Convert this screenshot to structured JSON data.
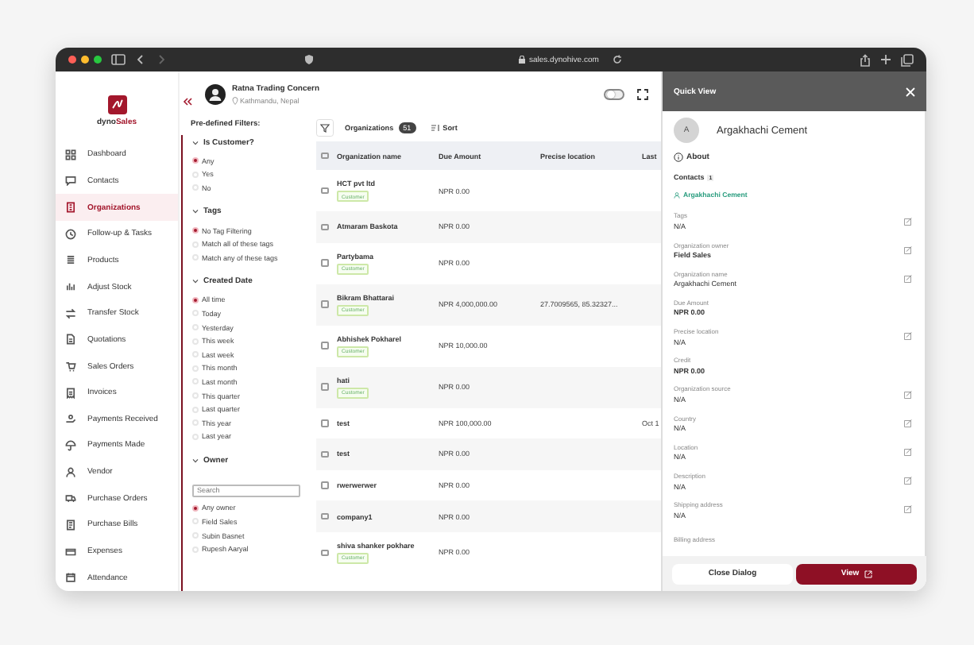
{
  "browser": {
    "url": "sales.dynohive.com"
  },
  "logo": {
    "part1": "dyno",
    "part2": "Sales"
  },
  "nav": [
    {
      "label": "Dashboard",
      "selected": false
    },
    {
      "label": "Contacts",
      "selected": false
    },
    {
      "label": "Organizations",
      "selected": true
    },
    {
      "label": "Follow-up & Tasks",
      "selected": false
    },
    {
      "label": "Products",
      "selected": false
    },
    {
      "label": "Adjust Stock",
      "selected": false
    },
    {
      "label": "Transfer Stock",
      "selected": false
    },
    {
      "label": "Quotations",
      "selected": false
    },
    {
      "label": "Sales Orders",
      "selected": false
    },
    {
      "label": "Invoices",
      "selected": false
    },
    {
      "label": "Payments Received",
      "selected": false
    },
    {
      "label": "Payments Made",
      "selected": false
    },
    {
      "label": "Vendor",
      "selected": false
    },
    {
      "label": "Purchase Orders",
      "selected": false
    },
    {
      "label": "Purchase Bills",
      "selected": false
    },
    {
      "label": "Expenses",
      "selected": false
    },
    {
      "label": "Attendance",
      "selected": false
    }
  ],
  "account": {
    "name": "Ratna Trading Concern",
    "location": "Kathmandu, Nepal"
  },
  "toggle": {
    "on": false
  },
  "filters": {
    "title": "Pre-defined Filters:",
    "sections": [
      {
        "title": "Is Customer?",
        "expanded": true,
        "options": [
          {
            "label": "Any",
            "selected": true
          },
          {
            "label": "Yes",
            "selected": false
          },
          {
            "label": "No",
            "selected": false
          }
        ]
      },
      {
        "title": "Tags",
        "expanded": true,
        "options": [
          {
            "label": "No Tag Filtering",
            "selected": true
          },
          {
            "label": "Match all of these tags",
            "selected": false
          },
          {
            "label": "Match any of these tags",
            "selected": false
          }
        ]
      },
      {
        "title": "Created Date",
        "expanded": true,
        "options": [
          {
            "label": "All time",
            "selected": true
          },
          {
            "label": "Today",
            "selected": false
          },
          {
            "label": "Yesterday",
            "selected": false
          },
          {
            "label": "This week",
            "selected": false
          },
          {
            "label": "Last week",
            "selected": false
          },
          {
            "label": "This month",
            "selected": false
          },
          {
            "label": "Last month",
            "selected": false
          },
          {
            "label": "This quarter",
            "selected": false
          },
          {
            "label": "Last quarter",
            "selected": false
          },
          {
            "label": "This year",
            "selected": false
          },
          {
            "label": "Last year",
            "selected": false
          }
        ]
      },
      {
        "title": "Owner",
        "expanded": true,
        "search_placeholder": "Search",
        "options": [
          {
            "label": "Any owner",
            "selected": true
          },
          {
            "label": "Field Sales",
            "selected": false
          },
          {
            "label": "Subin Basnet",
            "selected": false
          },
          {
            "label": "Rupesh Aaryal",
            "selected": false
          }
        ]
      }
    ]
  },
  "toolbar": {
    "label": "Organizations",
    "count": "51",
    "sort": "Sort"
  },
  "table": {
    "select_all_checked": false,
    "columns": [
      "Organization name",
      "Due Amount",
      "Precise location",
      "Last"
    ],
    "rows": [
      {
        "cells": [
          "HCT pvt ltd",
          "NPR 0.00",
          "",
          ""
        ],
        "tag": "Customer",
        "checked": false
      },
      {
        "cells": [
          "Atmaram Baskota",
          "NPR 0.00",
          "",
          ""
        ],
        "checked": false
      },
      {
        "cells": [
          "Partybama",
          "NPR 0.00",
          "",
          ""
        ],
        "tag": "Customer",
        "checked": false
      },
      {
        "cells": [
          "Bikram Bhattarai",
          "NPR 4,000,000.00",
          "27.7009565, 85.32327...",
          ""
        ],
        "tag": "Customer",
        "checked": false
      },
      {
        "cells": [
          "Abhishek Pokharel",
          "NPR 10,000.00",
          "",
          ""
        ],
        "tag": "Customer",
        "checked": false
      },
      {
        "cells": [
          "hati",
          "NPR 0.00",
          "",
          ""
        ],
        "tag": "Customer",
        "checked": false
      },
      {
        "cells": [
          "test",
          "NPR 100,000.00",
          "",
          "Oct 1"
        ],
        "checked": false
      },
      {
        "cells": [
          "test",
          "NPR 0.00",
          "",
          ""
        ],
        "checked": false
      },
      {
        "cells": [
          "rwerwerwer",
          "NPR 0.00",
          "",
          ""
        ],
        "checked": false
      },
      {
        "cells": [
          "company1",
          "NPR 0.00",
          "",
          ""
        ],
        "checked": false
      },
      {
        "cells": [
          "shiva shanker pokhare",
          "NPR 0.00",
          "",
          ""
        ],
        "tag": "Customer",
        "checked": false
      }
    ]
  },
  "quick_view": {
    "title": "Quick View",
    "avatar": "A",
    "name": "Argakhachi Cement",
    "about": "About",
    "contacts_label": "Contacts",
    "contacts_count": "1",
    "contact": "Argakhachi Cement",
    "fields": [
      {
        "label": "Tags",
        "value": "N/A",
        "editable": true
      },
      {
        "label": "Organization owner",
        "value": "Field Sales",
        "editable": true
      },
      {
        "label": "Organization name",
        "value": "Argakhachi Cement",
        "editable": true
      },
      {
        "label": "Due Amount",
        "value": "NPR 0.00",
        "editable": false
      },
      {
        "label": "Precise location",
        "value": "N/A",
        "editable": true
      },
      {
        "label": "Credit",
        "value": "NPR 0.00",
        "editable": false
      },
      {
        "label": "Organization source",
        "value": "N/A",
        "editable": true
      },
      {
        "label": "Country",
        "value": "N/A",
        "editable": true
      },
      {
        "label": "Location",
        "value": "N/A",
        "editable": true
      },
      {
        "label": "Description",
        "value": "N/A",
        "editable": true
      },
      {
        "label": "Shipping address",
        "value": "N/A",
        "editable": true
      },
      {
        "label": "Billing address",
        "editable": false
      }
    ],
    "buttons": [
      {
        "label": "Close Dialog",
        "kind": "secondary"
      },
      {
        "label": "View",
        "kind": "primary"
      }
    ]
  }
}
